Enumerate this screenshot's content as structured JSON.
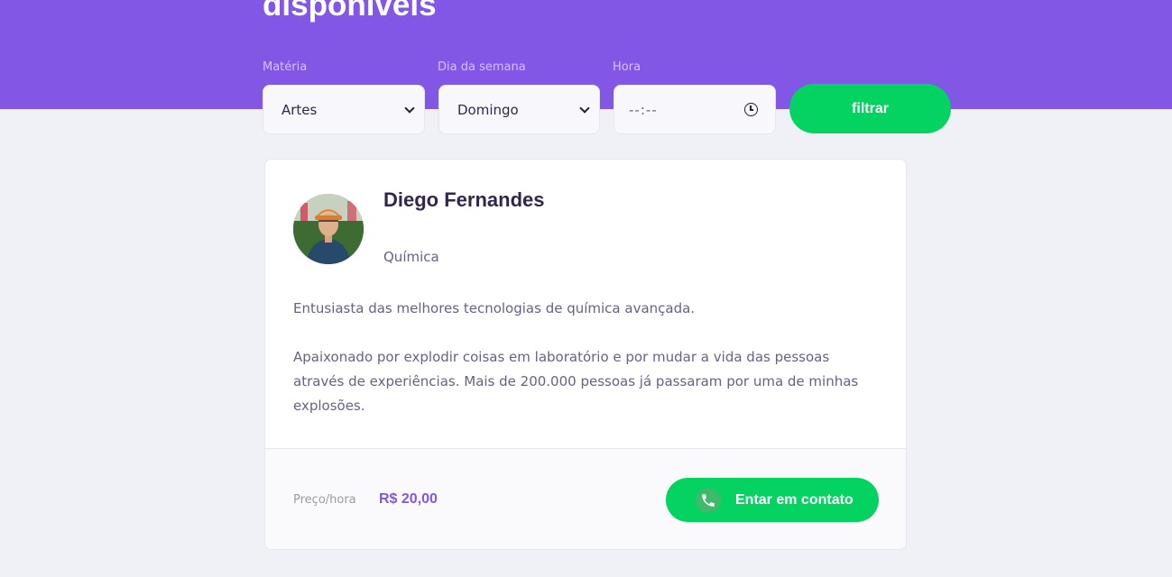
{
  "header": {
    "title": "disponíveis"
  },
  "filters": {
    "subject": {
      "label": "Matéria",
      "value": "Artes"
    },
    "weekday": {
      "label": "Dia da semana",
      "value": "Domingo"
    },
    "time": {
      "label": "Hora",
      "placeholder": "--:--"
    },
    "submit_label": "filtrar"
  },
  "teacher": {
    "name": "Diego Fernandes",
    "subject": "Química",
    "bio": [
      "Entusiasta das melhores tecnologias de química avançada.",
      "Apaixonado por explodir coisas em laboratório e por mudar a vida das pessoas através de experiências. Mais de 200.000 pessoas já passaram por uma de minhas explosões."
    ],
    "price_label": "Preço/hora",
    "price_value": "R$ 20,00",
    "contact_label": "Entar em contato"
  },
  "icons": {
    "select_arrow": "chevron-down-icon",
    "time": "clock-icon",
    "contact": "whatsapp-icon"
  },
  "colors": {
    "primary": "#8257E5",
    "secondary": "#04D361",
    "background": "#F0F0F7",
    "title_text": "#32264D",
    "body_text": "#6A6180"
  }
}
